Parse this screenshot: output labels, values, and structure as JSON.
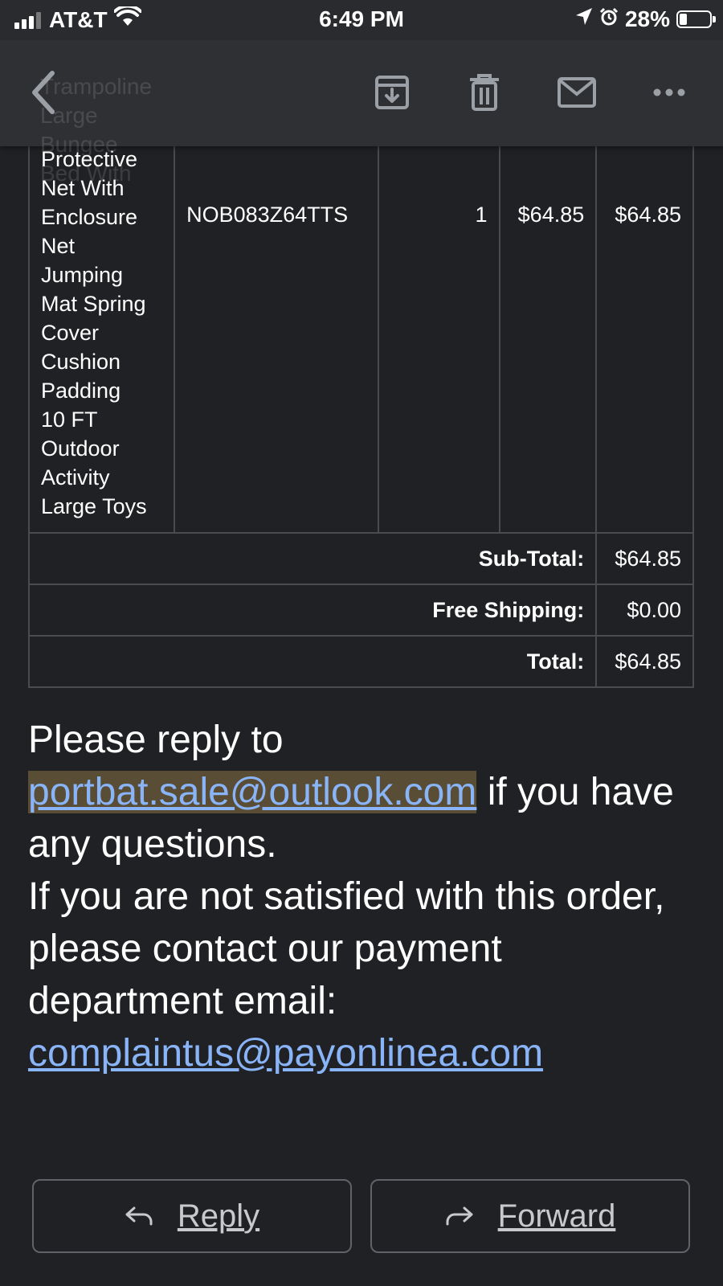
{
  "status_bar": {
    "carrier": "AT&T",
    "time": "6:49 PM",
    "battery": "28%"
  },
  "toolbar": {
    "ghost_lines": [
      "Trampoline",
      "Large",
      "Bungee",
      "Bed With"
    ]
  },
  "order": {
    "item_name_lines": [
      "Protective",
      "Net With",
      "Enclosure",
      "Net",
      "Jumping",
      "Mat Spring",
      "Cover",
      "Cushion",
      "Padding",
      "10 FT",
      "Outdoor",
      "Activity",
      "Large Toys"
    ],
    "sku": "NOB083Z64TTS",
    "qty": "1",
    "unit_price": "$64.85",
    "line_total": "$64.85",
    "summary": [
      {
        "label": "Sub-Total:",
        "value": "$64.85"
      },
      {
        "label": "Free Shipping:",
        "value": "$0.00"
      },
      {
        "label": "Total:",
        "value": "$64.85"
      }
    ]
  },
  "message": {
    "line1": "Please reply to",
    "email1": "portbat.sale@outlook.com",
    "after_email1": " if you have any questions.",
    "line2": "If you are not satisfied with this order, please contact our payment department email:",
    "email2": "complaintus@payonlinea.com"
  },
  "actions": {
    "reply": "Reply",
    "forward": "Forward"
  },
  "colors": {
    "background": "#202124",
    "link": "#8ab4f8",
    "highlight": "#5a4d35"
  }
}
